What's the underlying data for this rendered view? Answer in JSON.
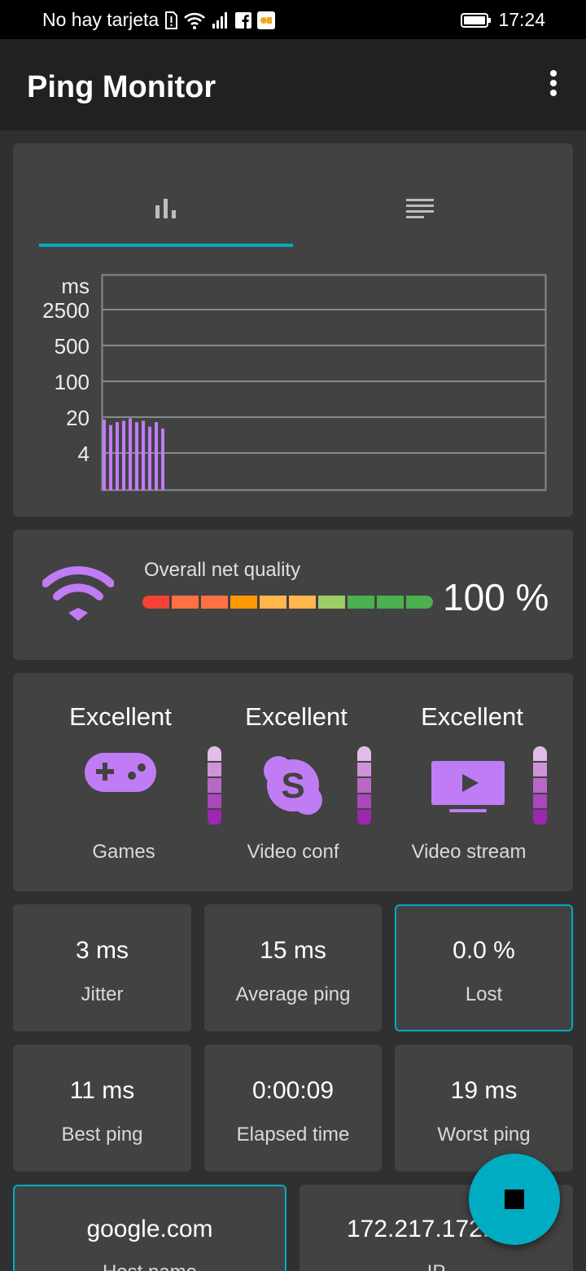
{
  "status_bar": {
    "carrier": "No hay tarjeta",
    "time": "17:24",
    "icons": [
      "sim-alert-icon",
      "wifi-icon",
      "signal-icon",
      "facebook-icon",
      "app-notification-icon",
      "battery-icon"
    ]
  },
  "app_bar": {
    "title": "Ping Monitor",
    "menu_icon": "more-vert-icon"
  },
  "tabs": [
    {
      "icon": "bar-chart-icon",
      "selected": true
    },
    {
      "icon": "list-icon",
      "selected": false
    }
  ],
  "chart_data": {
    "type": "bar",
    "ylabel": "ms",
    "y_scale": "log",
    "y_ticks": [
      "2500",
      "500",
      "100",
      "20",
      "4"
    ],
    "values": [
      18,
      14,
      16,
      17,
      19,
      16,
      17,
      13,
      16,
      12
    ],
    "color": "#c07cf5"
  },
  "net_quality": {
    "label": "Overall net quality",
    "value": "100 %",
    "segments": [
      "#f44336",
      "#ff7043",
      "#ff7043",
      "#ff9800",
      "#ffb74d",
      "#ffb74d",
      "#9ccc65",
      "#4caf50",
      "#4caf50",
      "#4caf50"
    ]
  },
  "qualities": [
    {
      "rating": "Excellent",
      "name": "Games",
      "icon": "gamepad-icon"
    },
    {
      "rating": "Excellent",
      "name": "Video conf",
      "icon": "skype-icon"
    },
    {
      "rating": "Excellent",
      "name": "Video stream",
      "icon": "tv-play-icon"
    }
  ],
  "quality_meter_colors": [
    "#e1bee7",
    "#ce93d8",
    "#ba68c8",
    "#ab47bc",
    "#9c27b0"
  ],
  "stats": [
    {
      "value": "3 ms",
      "label": "Jitter"
    },
    {
      "value": "15 ms",
      "label": "Average ping"
    },
    {
      "value": "0.0 %",
      "label": "Lost"
    },
    {
      "value": "11 ms",
      "label": "Best ping"
    },
    {
      "value": "0:00:09",
      "label": "Elapsed time"
    },
    {
      "value": "19 ms",
      "label": "Worst ping"
    }
  ],
  "host": {
    "value": "google.com",
    "label": "Host name"
  },
  "ip": {
    "value": "172.217.172.",
    "label": "IP"
  },
  "fab": {
    "icon": "stop-icon"
  },
  "accent": "#00acc1",
  "purple": "#c07cf5"
}
